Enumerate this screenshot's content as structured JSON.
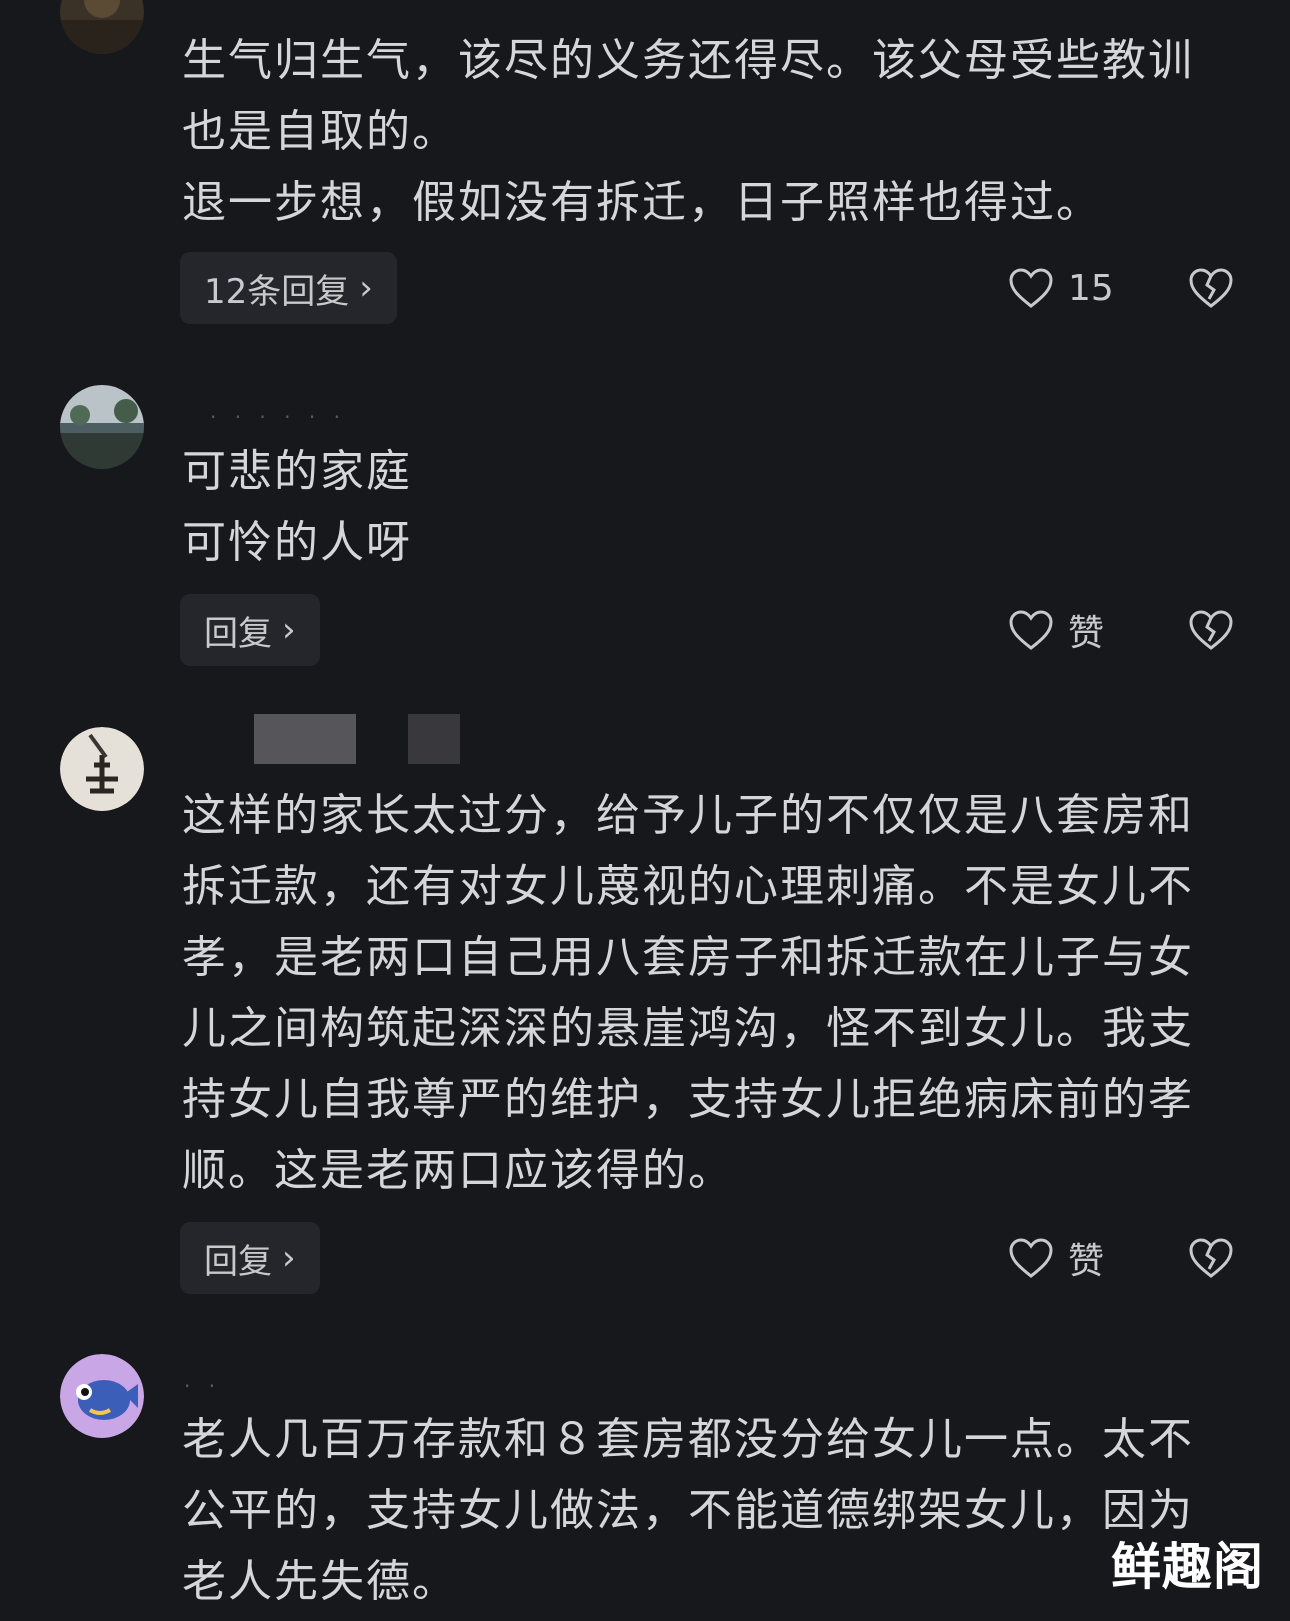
{
  "comments": [
    {
      "lines": [
        "生气归生气，该尽的义务还得尽。该父母受些教训",
        "也是自取的。",
        "退一步想，假如没有拆迁，日子照样也得过。"
      ],
      "reply_label": "12条回复",
      "like_label": "15"
    },
    {
      "lines": [
        "可悲的家庭",
        "可怜的人呀"
      ],
      "reply_label": "回复",
      "like_label": "赞"
    },
    {
      "lines": [
        "这样的家长太过分，给予儿子的不仅仅是八套房和",
        "拆迁款，还有对女儿蔑视的心理刺痛。不是女儿不",
        "孝，是老两口自己用八套房子和拆迁款在儿子与女",
        "儿之间构筑起深深的悬崖鸿沟，怪不到女儿。我支",
        "持女儿自我尊严的维护，支持女儿拒绝病床前的孝",
        "顺。这是老两口应该得的。"
      ],
      "reply_label": "回复",
      "like_label": "赞"
    },
    {
      "lines": [
        "老人几百万存款和８套房都没分给女儿一点。太不",
        "公平的，支持女儿做法，不能道德绑架女儿，因为",
        "老人先失德。"
      ]
    }
  ],
  "icons": {
    "like": "heart-outline-icon",
    "dislike": "broken-heart-icon",
    "chevron": "chevron-right-icon"
  },
  "colors": {
    "background": "#17181c",
    "text": "#d6d6d8",
    "button_bg": "#25262b",
    "watermark": "#ffffff"
  },
  "watermark": "鲜趣阁"
}
